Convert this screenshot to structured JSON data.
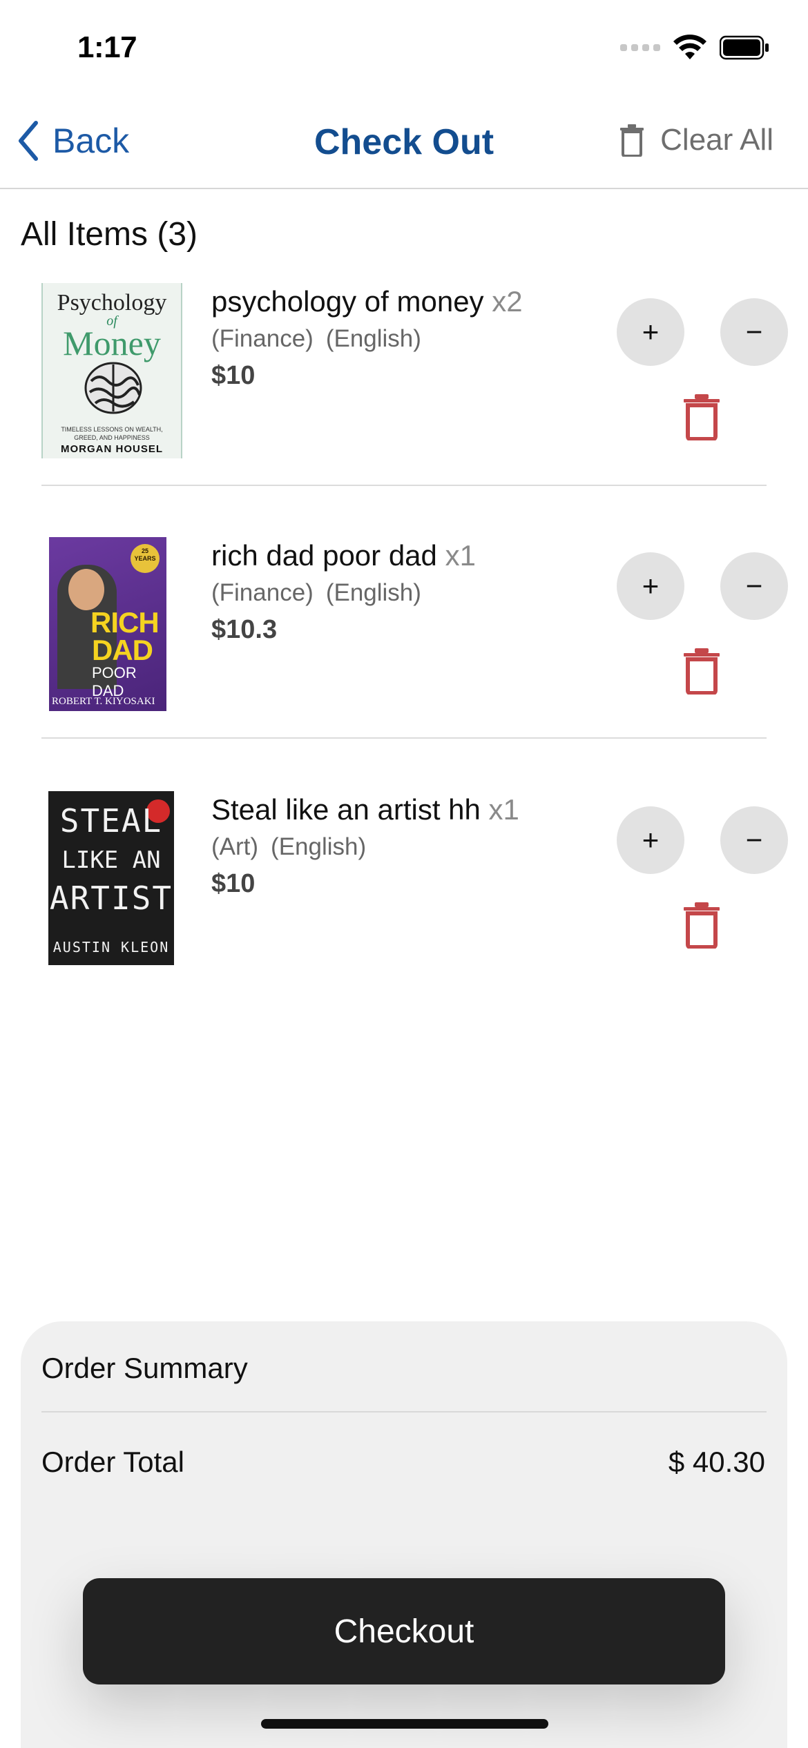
{
  "status_bar": {
    "time": "1:17"
  },
  "nav": {
    "back_label": "Back",
    "title": "Check Out",
    "clear_label": "Clear All"
  },
  "section": {
    "title": "All Items (3)"
  },
  "items": [
    {
      "name": "psychology of money",
      "qty": "x2",
      "tags": [
        "(Finance)",
        "(English)"
      ],
      "price": "$10",
      "cover": {
        "line1": "Psychology",
        "line2": "of",
        "line3": "Money",
        "subtitle": "TIMELESS LESSONS ON WEALTH, GREED, AND HAPPINESS",
        "author": "MORGAN HOUSEL"
      },
      "plus": "+",
      "minus": "−"
    },
    {
      "name": "rich dad poor dad",
      "qty": "x1",
      "tags": [
        "(Finance)",
        "(English)"
      ],
      "price": "$10.3",
      "cover": {
        "line1": "RICH",
        "line2": "DAD",
        "line3": "POOR DAD",
        "author": "ROBERT T. KIYOSAKI",
        "badge": "25 YEARS"
      },
      "plus": "+",
      "minus": "−"
    },
    {
      "name": "Steal like an artist hh",
      "qty": "x1",
      "tags": [
        "(Art)",
        "(English)"
      ],
      "price": "$10",
      "cover": {
        "line1": "STEAL",
        "line2": "LIKE AN",
        "line3": "ARTIST",
        "author": "AUSTIN KLEON"
      },
      "plus": "+",
      "minus": "−"
    }
  ],
  "summary": {
    "title": "Order Summary",
    "total_label": "Order Total",
    "total_value": "$ 40.30"
  },
  "checkout": {
    "label": "Checkout"
  },
  "colors": {
    "accent": "#134d8f",
    "trash": "#c4474a",
    "button_dark": "#222222"
  }
}
